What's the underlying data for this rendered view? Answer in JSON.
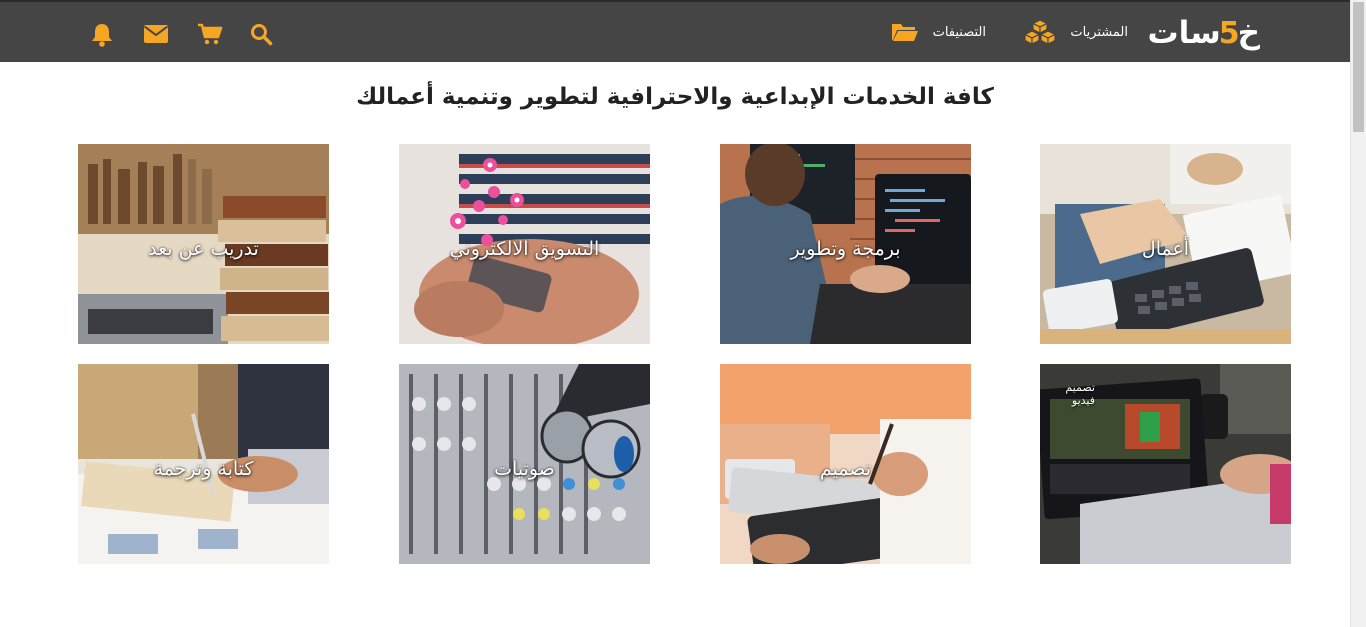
{
  "header": {
    "brand_main": "خـسات",
    "brand_digit": "5",
    "purchases_label": "المشتريات",
    "categories_label": "التصنيفات"
  },
  "heading": "كافة الخدمات الإبداعية والاحترافية لتطوير وتنمية أعمالك",
  "categories": [
    {
      "label": "أعمال"
    },
    {
      "label": "برمجة وتطوير"
    },
    {
      "label": "التسويق الالكتروني"
    },
    {
      "label": "تدريب عن بعد"
    },
    {
      "label": "تصميم فيديو"
    },
    {
      "label": "تصميم"
    },
    {
      "label": "صوتيات"
    },
    {
      "label": "كتابة وترجمة"
    }
  ],
  "icons": {
    "brand": "cubes-icon",
    "categories": "folder-icon",
    "toolbar": [
      "search-icon",
      "cart-icon",
      "envelope-icon",
      "bell-icon"
    ]
  },
  "colors": {
    "navbar": "#454545",
    "accent": "#f5a623",
    "heading": "#222222"
  }
}
